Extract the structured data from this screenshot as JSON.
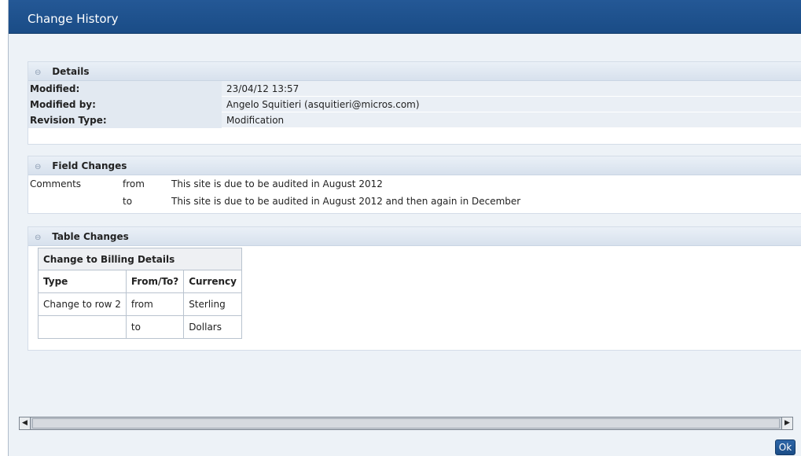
{
  "dialog": {
    "title": "Change History"
  },
  "details": {
    "heading": "Details",
    "rows": [
      {
        "label": "Modified:",
        "value": "23/04/12 13:57"
      },
      {
        "label": "Modified by:",
        "value": "Angelo Squitieri (asquitieri@micros.com)"
      },
      {
        "label": "Revision Type:",
        "value": "Modification"
      }
    ]
  },
  "field_changes": {
    "heading": "Field Changes",
    "field": "Comments",
    "from_label": "from",
    "from_value": "This site is due to be audited in August 2012",
    "to_label": "to",
    "to_value": "This site is due to be audited in August 2012 and then again in December"
  },
  "table_changes": {
    "heading": "Table Changes",
    "caption": "Change to Billing Details",
    "columns": [
      "Type",
      "From/To?",
      "Currency"
    ],
    "rows": [
      [
        "Change to row 2",
        "from",
        "Sterling"
      ],
      [
        "",
        "to",
        "Dollars"
      ]
    ]
  },
  "icons": {
    "collapse": "collapse-icon",
    "scroll_left": "arrow-left-icon",
    "scroll_right": "arrow-right-icon"
  },
  "footer": {
    "ok_label": "Ok"
  }
}
